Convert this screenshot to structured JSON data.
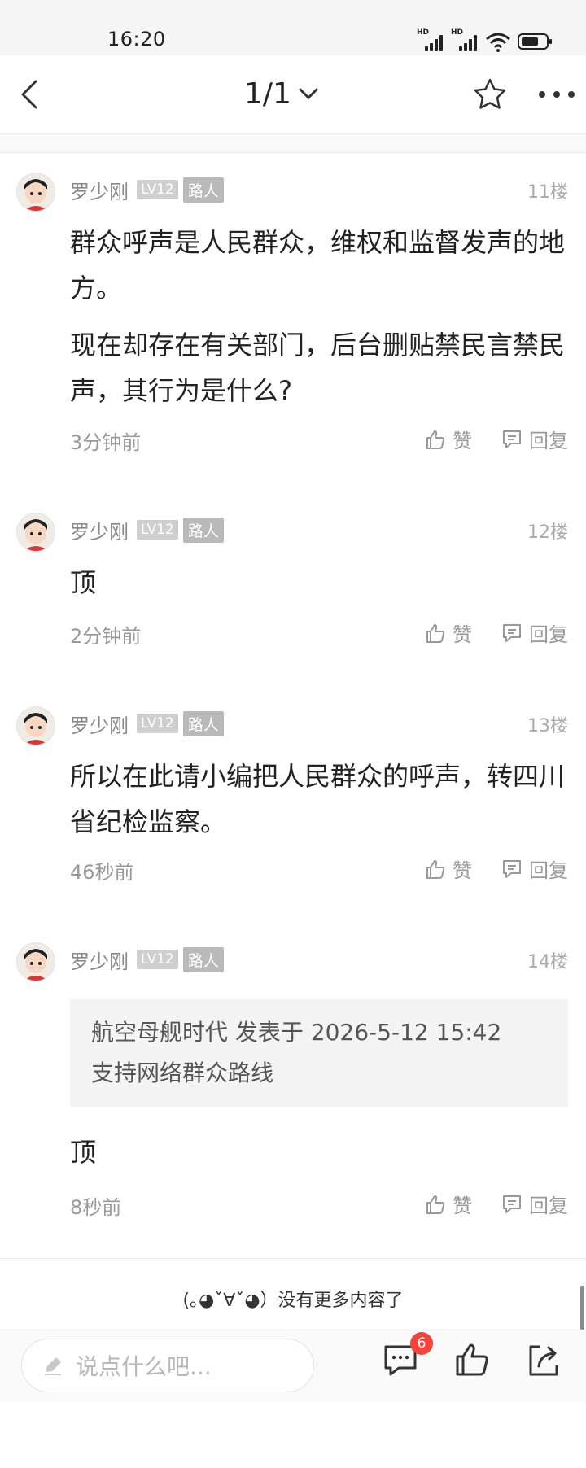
{
  "status_bar": {
    "time": "16:20"
  },
  "nav": {
    "page_indicator": "1/1"
  },
  "posts": [
    {
      "username": "罗少刚",
      "level": "LV12",
      "role": "路人",
      "floor": "11楼",
      "paragraphs": [
        "群众呼声是人民群众，维权和监督发声的地方。",
        "现在却存在有关部门，后台删贴禁民言禁民声，其行为是什么?"
      ],
      "time": "3分钟前",
      "like_label": "赞",
      "reply_label": "回复"
    },
    {
      "username": "罗少刚",
      "level": "LV12",
      "role": "路人",
      "floor": "12楼",
      "paragraphs": [
        "顶"
      ],
      "time": "2分钟前",
      "like_label": "赞",
      "reply_label": "回复"
    },
    {
      "username": "罗少刚",
      "level": "LV12",
      "role": "路人",
      "floor": "13楼",
      "paragraphs": [
        "所以在此请小编把人民群众的呼声，转四川省纪检监察。"
      ],
      "time": "46秒前",
      "like_label": "赞",
      "reply_label": "回复"
    },
    {
      "username": "罗少刚",
      "level": "LV12",
      "role": "路人",
      "floor": "14楼",
      "quote": {
        "meta": "航空母舰时代 发表于 2026-5-12 15:42",
        "text": "支持网络群众路线"
      },
      "paragraphs": [
        "顶"
      ],
      "time": "8秒前",
      "like_label": "赞",
      "reply_label": "回复"
    }
  ],
  "end_message": "(｡◕ˇ∀ˇ◕）没有更多内容了",
  "bottom_bar": {
    "input_placeholder": "说点什么吧...",
    "comment_count": "6"
  },
  "icons": [
    "back-arrow-icon",
    "chevron-down-icon",
    "star-icon",
    "more-icon",
    "thumbs-up-icon",
    "comment-icon",
    "pencil-icon",
    "share-icon"
  ]
}
